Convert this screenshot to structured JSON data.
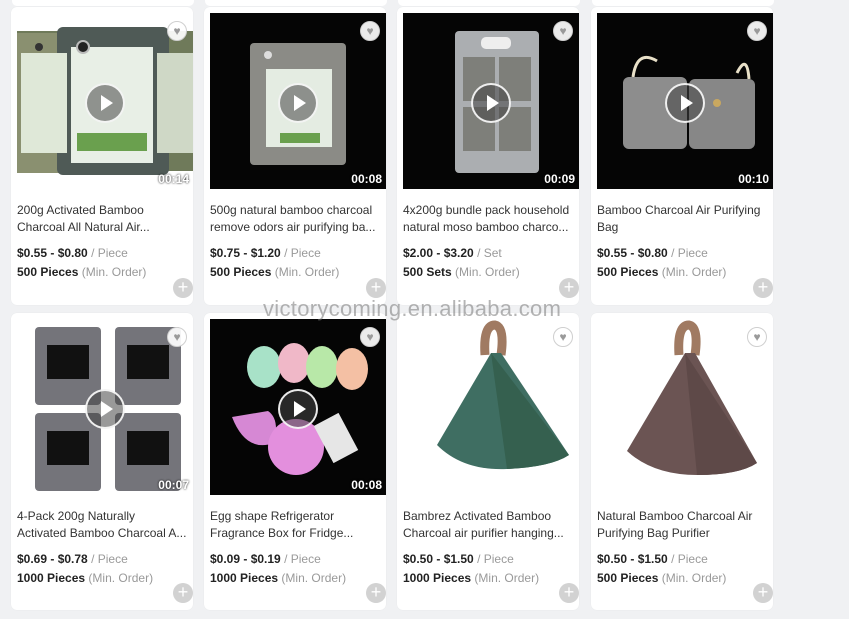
{
  "watermark": "victorycoming.en.alibaba.com",
  "products": [
    {
      "duration": "00:14",
      "title": "200g Activated Bamboo\nCharcoal All Natural Air...",
      "price": "$0.55 - $0.80",
      "unit": "/ Piece",
      "moq": "500 Pieces",
      "moq_label": "(Min. Order)"
    },
    {
      "duration": "00:08",
      "title": "500g natural bamboo charcoal\nremove odors air purifying ba...",
      "price": "$0.75 - $1.20",
      "unit": "/ Piece",
      "moq": "500 Pieces",
      "moq_label": "(Min. Order)"
    },
    {
      "duration": "00:09",
      "title": "4x200g bundle pack household\nnatural moso bamboo charco...",
      "price": "$2.00 - $3.20",
      "unit": "/ Set",
      "moq": "500 Sets",
      "moq_label": "(Min. Order)"
    },
    {
      "duration": "00:10",
      "title": "Bamboo Charcoal Air Purifying\nBag",
      "price": "$0.55 - $0.80",
      "unit": "/ Piece",
      "moq": "500 Pieces",
      "moq_label": "(Min. Order)"
    },
    {
      "duration": "00:07",
      "title": "4-Pack 200g Naturally\nActivated Bamboo Charcoal A...",
      "price": "$0.69 - $0.78",
      "unit": "/ Piece",
      "moq": "1000 Pieces",
      "moq_label": "(Min. Order)"
    },
    {
      "duration": "00:08",
      "title": "Egg shape Refrigerator\nFragrance Box for Fridge...",
      "price": "$0.09 - $0.19",
      "unit": "/ Piece",
      "moq": "1000 Pieces",
      "moq_label": "(Min. Order)"
    },
    {
      "duration": "",
      "title": "Bambrez Activated Bamboo\nCharcoal air purifier hanging...",
      "price": "$0.50 - $1.50",
      "unit": "/ Piece",
      "moq": "1000 Pieces",
      "moq_label": "(Min. Order)"
    },
    {
      "duration": "",
      "title": "Natural Bamboo Charcoal Air\nPurifying Bag Purifier",
      "price": "$0.50 - $1.50",
      "unit": "/ Piece",
      "moq": "500 Pieces",
      "moq_label": "(Min. Order)"
    }
  ]
}
